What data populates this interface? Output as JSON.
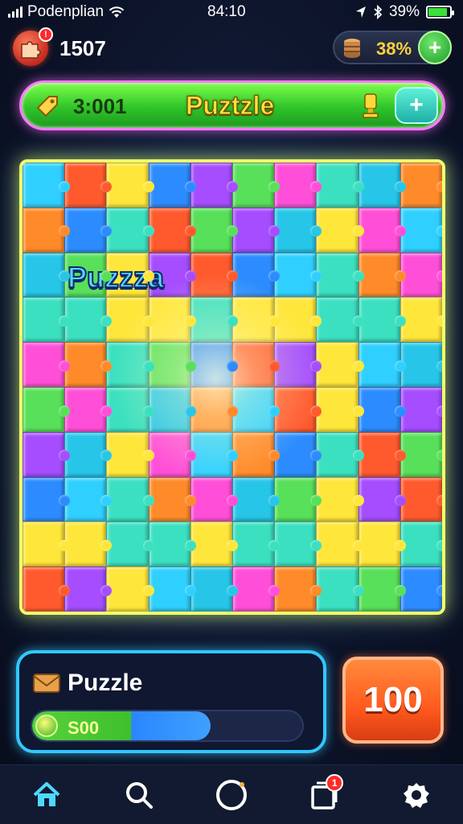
{
  "status_bar": {
    "carrier": "Podenplian",
    "time": "84:10",
    "battery": "39%",
    "battery_level": 0.9
  },
  "header": {
    "lives_badge": "!",
    "lives_count": "1507",
    "coin_value": "38%",
    "coin_plus": "+"
  },
  "banner": {
    "count": "3:001",
    "title": "Puztzle",
    "action": "+"
  },
  "board": {
    "overlay_label": "Puzzza",
    "colors": [
      "#2fd0ff",
      "#2c8cff",
      "#ff4fd8",
      "#ff8a2a",
      "#ffe63a",
      "#58e05a",
      "#27c6e8",
      "#ff5a2e",
      "#a54dff",
      "#3be0c0"
    ]
  },
  "progress_panel": {
    "title": "Puzzle",
    "value": "S00",
    "progress": 0.66
  },
  "score_button": {
    "label": "100"
  },
  "tabbar": {
    "items": [
      {
        "name": "home",
        "icon": "home-icon"
      },
      {
        "name": "search",
        "icon": "search-icon"
      },
      {
        "name": "play",
        "icon": "circle-icon"
      },
      {
        "name": "inbox",
        "icon": "clipboard-icon",
        "badge": "1"
      },
      {
        "name": "settings",
        "icon": "gear-icon"
      }
    ]
  },
  "colors": {
    "accent": "#31c8ff",
    "banner_green": "#2fc42a",
    "orange": "#ff5a1e"
  }
}
